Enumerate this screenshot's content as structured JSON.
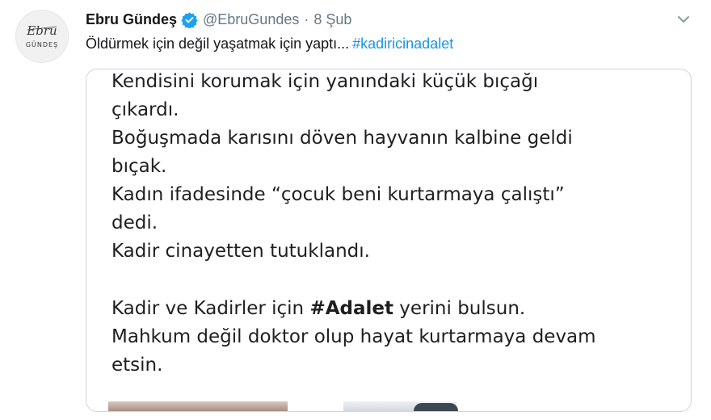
{
  "author": {
    "display_name": "Ebru Gündeş",
    "handle": "@EbruGundes",
    "separator": "·",
    "time": "8 Şub",
    "avatar_logo_top": "Ebru",
    "avatar_logo_bottom": "GÜNDEŞ"
  },
  "tweet": {
    "text": "Öldürmek için değil yaşatmak için yaptı...",
    "hashtag": "#kadiricinadalet"
  },
  "media": {
    "lines": [
      "Kendisini korumak için yanındaki küçük bıçağı",
      "çıkardı.",
      "Boğuşmada karısını döven hayvanın kalbine geldi",
      "bıçak.",
      "Kadın ifadesinde “çocuk beni kurtarmaya çalıştı”",
      "dedi.",
      "Kadir cinayetten tutuklandı.",
      "",
      "Mahkum değil doktor olup hayat kurtarmaya devam",
      "etsin."
    ],
    "line_with_hashtag": {
      "before": "Kadir ve Kadirler için ",
      "bold": "#Adalet",
      "after": " yerini bulsun."
    }
  },
  "icons": {
    "verified": "verified-badge-icon",
    "caret": "chevron-down-icon"
  },
  "colors": {
    "link": "#1b95e0",
    "secondary_text": "#657786",
    "verified": "#1da1f2",
    "border": "#ccd6dd"
  }
}
